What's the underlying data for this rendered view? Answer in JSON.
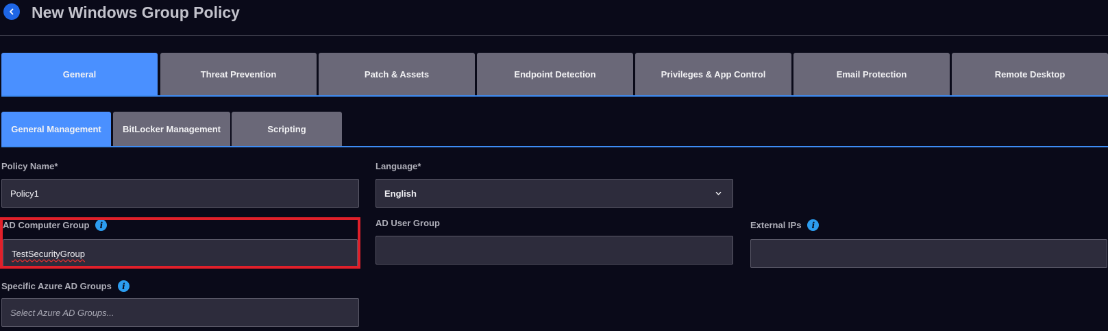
{
  "header": {
    "title": "New Windows Group Policy",
    "back_icon": "chevron-left-icon"
  },
  "main_tabs": [
    {
      "label": "General",
      "active": true
    },
    {
      "label": "Threat Prevention",
      "active": false
    },
    {
      "label": "Patch & Assets",
      "active": false
    },
    {
      "label": "Endpoint Detection",
      "active": false
    },
    {
      "label": "Privileges & App Control",
      "active": false
    },
    {
      "label": "Email Protection",
      "active": false
    },
    {
      "label": "Remote Desktop",
      "active": false
    }
  ],
  "sub_tabs": [
    {
      "label": "General Management",
      "active": true
    },
    {
      "label": "BitLocker Management",
      "active": false
    },
    {
      "label": "Scripting",
      "active": false
    }
  ],
  "form": {
    "policy_name": {
      "label": "Policy Name*",
      "value": "Policy1"
    },
    "language": {
      "label": "Language*",
      "value": "English"
    },
    "ad_computer_group": {
      "label": "AD Computer Group",
      "value": "TestSecurityGroup"
    },
    "ad_user_group": {
      "label": "AD User Group",
      "value": ""
    },
    "external_ips": {
      "label": "External IPs",
      "value": ""
    },
    "azure_ad_groups": {
      "label": "Specific Azure AD Groups",
      "placeholder": "Select Azure AD Groups..."
    }
  },
  "colors": {
    "background": "#0a0a19",
    "active_tab": "#4a90ff",
    "inactive_tab": "#6a6878",
    "highlight": "#e0202a",
    "info": "#2c9df0"
  }
}
